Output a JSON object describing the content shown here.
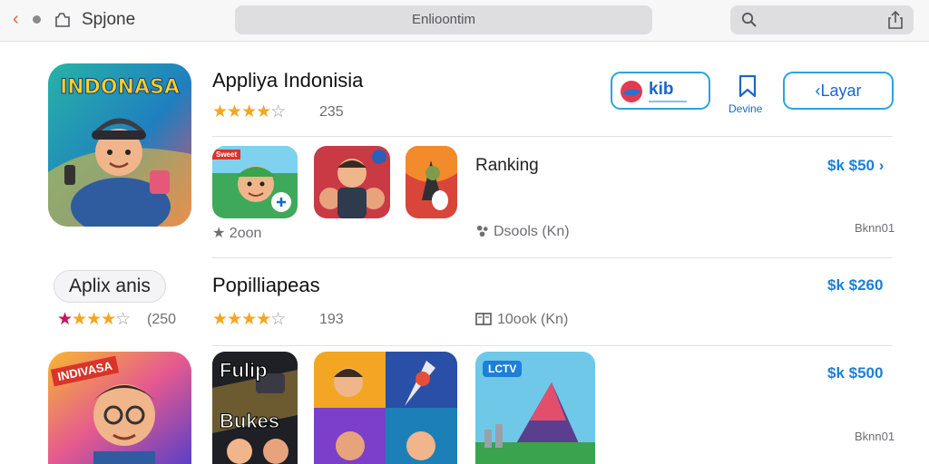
{
  "browser": {
    "site_name": "Spjone",
    "url_text": "Enlioontim"
  },
  "app": {
    "title": "Appliya Indonisia",
    "rating_count": "235",
    "icon_banner": "INDONASA",
    "actions": {
      "kib_label": "kib",
      "bookmark_label": "Devine",
      "layar_label": "‹Layar"
    }
  },
  "ranking": {
    "label": "Ranking",
    "price": "$k $50 ›",
    "stat_left": "★ 2oon",
    "stat_mid": "Dsools (Kn)",
    "stat_right": "Bknn01",
    "thumb1_badge": "Sweet"
  },
  "section2": {
    "pill_label": "Aplix anis",
    "pill_rating_count": "(250",
    "title": "Popilliapeas",
    "rating_count": "193",
    "meta": "10ook (Kn)",
    "price": "$k $260"
  },
  "section3": {
    "icon_banner": "INDIVASA",
    "thumb1_top": "Fulip",
    "thumb1_bottom": "Bukes",
    "thumb3_badge": "LCTV",
    "price": "$k $500",
    "meta_right": "Bknn01"
  },
  "colors": {
    "accent_blue": "#1c7fd8",
    "star_gold": "#f2a623",
    "back_orange": "#e0652c"
  }
}
